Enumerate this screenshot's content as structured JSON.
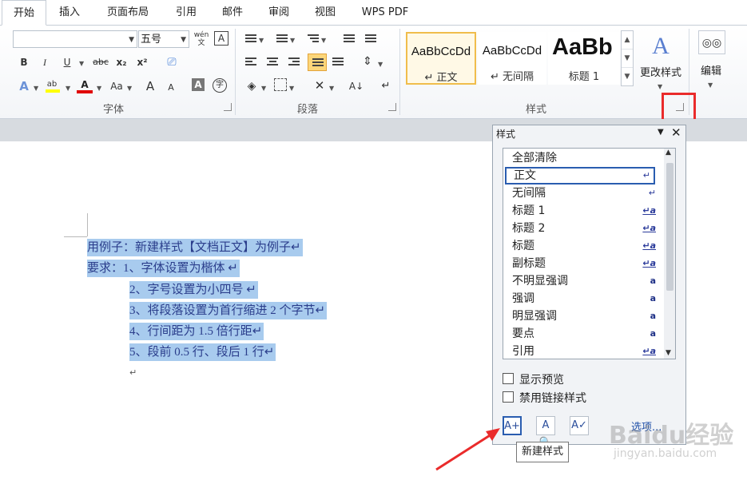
{
  "tabs": [
    "开始",
    "插入",
    "页面布局",
    "引用",
    "邮件",
    "审阅",
    "视图",
    "WPS PDF"
  ],
  "active_tab": "开始",
  "ribbon": {
    "font_name_value": "",
    "font_size_value": "五号",
    "group_font": "字体",
    "group_paragraph": "段落",
    "group_styles": "样式",
    "change_styles": "更改样式",
    "edit": "编辑",
    "styles_gallery": [
      {
        "sample": "AaBbCcDd",
        "name": "↵ 正文",
        "selected": true
      },
      {
        "sample": "AaBbCcDd",
        "name": "↵ 无间隔",
        "selected": false
      },
      {
        "sample": "AaBb",
        "name": "标题 1",
        "selected": false
      }
    ],
    "icons": {
      "bold": "B",
      "italic": "I",
      "underline": "U",
      "strike": "abc",
      "subscript": "x₂",
      "superscript": "x²",
      "grow": "A",
      "shrink": "A",
      "change_case": "Aa",
      "wen": "wén",
      "char_border": "A"
    },
    "colors": {
      "highlight": "#ffff00",
      "font_color": "#e00000",
      "accent": "#f0bd4c",
      "callout": "#ea2b2b"
    }
  },
  "document": {
    "lines": [
      "用例子：新建样式【文档正文】为例子↵",
      "要求：1、字体设置为楷体 ↵",
      "2、字号设置为小四号 ↵",
      "3、将段落设置为首行缩进 2 个字节↵",
      "4、行间距为 1.5 倍行距↵",
      "5、段前 0.5 行、段后 1 行↵"
    ],
    "empty_para": "↵"
  },
  "styles_pane": {
    "title": "样式",
    "items": [
      {
        "label": "全部清除",
        "mark": ""
      },
      {
        "label": "正文",
        "mark": "↵",
        "selected": true
      },
      {
        "label": "无间隔",
        "mark": "↵"
      },
      {
        "label": "标题 1",
        "mark": "↵a"
      },
      {
        "label": "标题 2",
        "mark": "↵a"
      },
      {
        "label": "标题",
        "mark": "↵a"
      },
      {
        "label": "副标题",
        "mark": "↵a"
      },
      {
        "label": "不明显强调",
        "mark": "a"
      },
      {
        "label": "强调",
        "mark": "a"
      },
      {
        "label": "明显强调",
        "mark": "a"
      },
      {
        "label": "要点",
        "mark": "a"
      },
      {
        "label": "引用",
        "mark": "↵a"
      }
    ],
    "show_preview": "显示预览",
    "disable_linked": "禁用链接样式",
    "options": "选项...",
    "tooltip": "新建样式"
  },
  "watermark": {
    "brand": "Baidu经验",
    "url": "jingyan.baidu.com"
  }
}
